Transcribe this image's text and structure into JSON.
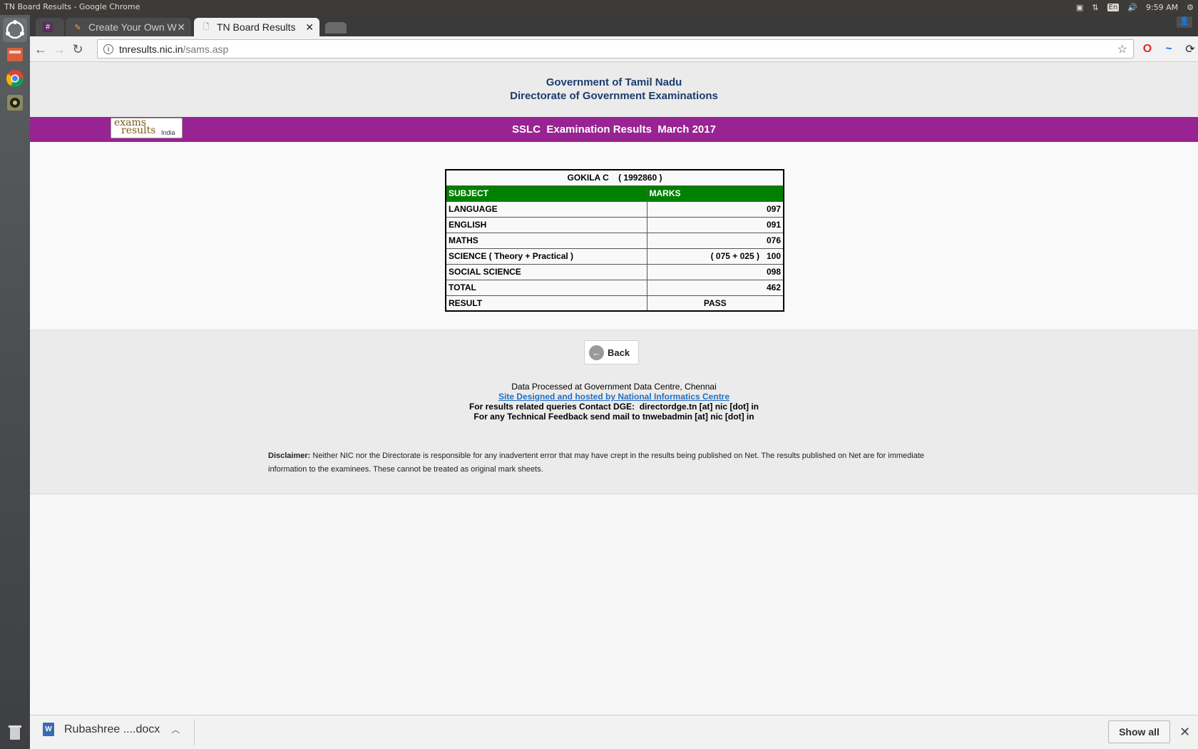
{
  "os": {
    "window_title": "TN Board Results - Google Chrome",
    "keyboard_layout": "En",
    "time": "9:59 AM"
  },
  "browser": {
    "tabs": [
      {
        "label": "#",
        "active": false,
        "icon": "slack-icon"
      },
      {
        "label": "Create Your Own W",
        "active": false,
        "icon": "page-icon"
      },
      {
        "label": "TN Board Results",
        "active": true,
        "icon": "document-icon"
      }
    ],
    "url_host": "tnresults.nic.in",
    "url_path": "/sams.asp"
  },
  "header": {
    "line1": "Government of Tamil Nadu",
    "line2": "Directorate of Government Examinations"
  },
  "banner": {
    "title": "SSLC  Examination Results  March 2017",
    "logo_line1": "exams",
    "logo_line2": "results",
    "logo_line3": "India"
  },
  "results": {
    "student": "GOKILA C    ( 1992860 )",
    "col_subject": "SUBJECT",
    "col_marks": "MARKS",
    "rows": [
      {
        "subject": "LANGUAGE",
        "marks": "097"
      },
      {
        "subject": "ENGLISH",
        "marks": "091"
      },
      {
        "subject": "MATHS",
        "marks": "076"
      },
      {
        "subject": "SCIENCE ( Theory + Practical )",
        "marks": "( 075 + 025 )   100"
      },
      {
        "subject": "SOCIAL SCIENCE",
        "marks": "098"
      },
      {
        "subject": "TOTAL",
        "marks": "462"
      }
    ],
    "result_label": "RESULT",
    "result_value": "PASS"
  },
  "footer": {
    "back_label": "Back",
    "processed": "Data Processed at Government Data Centre, Chennai",
    "site_link": "Site Designed and hosted by National Informatics Centre",
    "contact": "For results related queries Contact DGE:  directordge.tn [at] nic [dot] in",
    "feedback": "For any Technical Feedback send mail to tnwebadmin [at] nic [dot] in",
    "disclaimer_label": "Disclaimer:",
    "disclaimer_text": " Neither NIC nor the Directorate is responsible for any inadvertent error that may have crept in the results being published on Net. The results published on Net are for immediate information to the examinees. These cannot be treated as original mark sheets."
  },
  "downloads": {
    "file_name": "Rubashree ....docx",
    "show_all": "Show all"
  }
}
